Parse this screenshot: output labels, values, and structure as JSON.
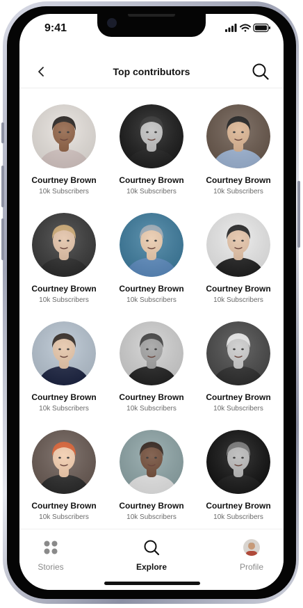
{
  "status": {
    "time": "9:41"
  },
  "header": {
    "title": "Top contributors"
  },
  "contributors": [
    {
      "name": "Courtney Brown",
      "subs": "10k Subscribers",
      "bg": "#e9e4df",
      "skin": "#8a5a3c",
      "hair": "#1f1a17",
      "shirt": "#d8c9c6"
    },
    {
      "name": "Courtney Brown",
      "subs": "10k Subscribers",
      "bg": "#1b1b1b",
      "skin": "#bdbdbd",
      "hair": "#2a2a2a",
      "shirt": "#202020"
    },
    {
      "name": "Courtney Brown",
      "subs": "10k Subscribers",
      "bg": "#6b5a4e",
      "skin": "#d9b08c",
      "hair": "#151515",
      "shirt": "#9fb6d6"
    },
    {
      "name": "Courtney Brown",
      "subs": "10k Subscribers",
      "bg": "#3a3a3a",
      "skin": "#e1bfa3",
      "hair": "#c9a46c",
      "shirt": "#2b2b2b"
    },
    {
      "name": "Courtney Brown",
      "subs": "10k Subscribers",
      "bg": "#3f7ea0",
      "skin": "#e8c7a8",
      "hair": "#9aa9b5",
      "shirt": "#5c8cc0"
    },
    {
      "name": "Courtney Brown",
      "subs": "10k Subscribers",
      "bg": "#ececec",
      "skin": "#e2bfa2",
      "hair": "#1c1c1c",
      "shirt": "#1f1f1f"
    },
    {
      "name": "Courtney Brown",
      "subs": "10k Subscribers",
      "bg": "#b9c6d3",
      "skin": "#e4c2a4",
      "hair": "#2a211b",
      "shirt": "#1c2442"
    },
    {
      "name": "Courtney Brown",
      "subs": "10k Subscribers",
      "bg": "#d2d2d2",
      "skin": "#9c9c9c",
      "hair": "#3a3a3a",
      "shirt": "#222222"
    },
    {
      "name": "Courtney Brown",
      "subs": "10k Subscribers",
      "bg": "#4a4a4a",
      "skin": "#c8c8c8",
      "hair": "#e8e8e8",
      "shirt": "#2e2e2e"
    },
    {
      "name": "Courtney Brown",
      "subs": "10k Subscribers",
      "bg": "#6b5c55",
      "skin": "#f1c9a8",
      "hair": "#d85a2a",
      "shirt": "#2a2a2a"
    },
    {
      "name": "Courtney Brown",
      "subs": "10k Subscribers",
      "bg": "#8fa6a8",
      "skin": "#6b4530",
      "hair": "#2a1a12",
      "shirt": "#e8e8e8"
    },
    {
      "name": "Courtney Brown",
      "subs": "10k Subscribers",
      "bg": "#111111",
      "skin": "#b5b5b5",
      "hair": "#707070",
      "shirt": "#1a1a1a"
    }
  ],
  "tabs": [
    {
      "label": "Stories",
      "icon": "grid-icon"
    },
    {
      "label": "Explore",
      "icon": "search-icon"
    },
    {
      "label": "Profile",
      "icon": "avatar"
    }
  ]
}
